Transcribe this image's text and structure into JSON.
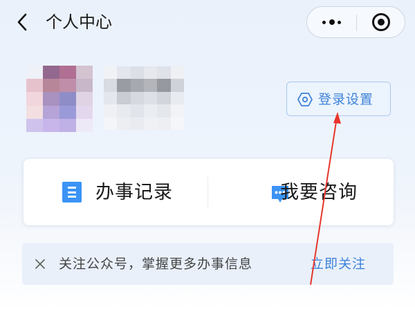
{
  "header": {
    "title": "个人中心",
    "back_icon": "chevron-left-icon",
    "more_icon": "more-dots-icon",
    "close_icon": "target-close-icon"
  },
  "profile": {
    "avatar": "pixelated-avatar",
    "username": "pixelated-username",
    "login_settings_label": "登录设置",
    "login_settings_icon": "hexagon-gear-icon"
  },
  "actions": [
    {
      "label": "办事记录",
      "icon": "document-icon",
      "color": "#3b93f5"
    },
    {
      "label": "我要咨询",
      "icon": "chat-bubble-icon",
      "color": "#3b93f5"
    }
  ],
  "notice": {
    "close_icon": "close-icon",
    "text": "关注公众号，掌握更多办事信息",
    "follow_label": "立即关注"
  },
  "colors": {
    "accent": "#3e82d8",
    "annotation": "#e8352b"
  }
}
